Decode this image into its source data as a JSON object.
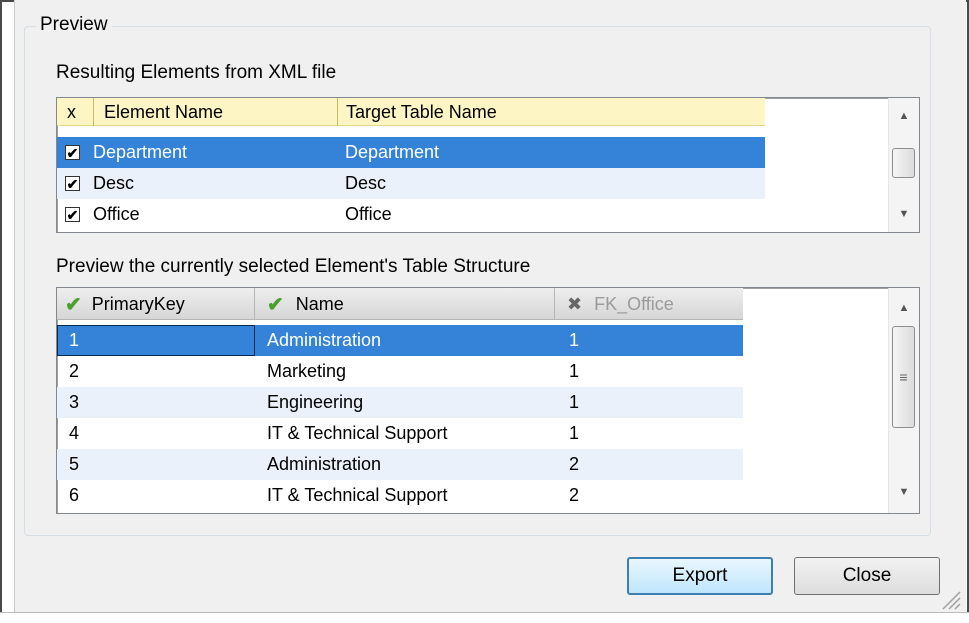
{
  "preview": {
    "group_title": "Preview",
    "elements_label": "Resulting Elements from XML file",
    "elements_table": {
      "headers": [
        "x",
        "Element Name",
        "Target Table Name"
      ],
      "rows": [
        {
          "checked": true,
          "element": "Department",
          "target": "Department",
          "selected": true
        },
        {
          "checked": true,
          "element": "Desc",
          "target": "Desc",
          "selected": false
        },
        {
          "checked": true,
          "element": "Office",
          "target": "Office",
          "selected": false
        }
      ]
    },
    "structure_label": "Preview the currently selected Element's Table Structure",
    "structure_table": {
      "headers": [
        {
          "label": "PrimaryKey",
          "icon": "check-icon"
        },
        {
          "label": "Name",
          "icon": "check-icon"
        },
        {
          "label": "FK_Office",
          "icon": "x-icon"
        }
      ],
      "rows": [
        [
          "1",
          "Administration",
          "1"
        ],
        [
          "2",
          "Marketing",
          "1"
        ],
        [
          "3",
          "Engineering",
          "1"
        ],
        [
          "4",
          "IT & Technical Support",
          "1"
        ],
        [
          "5",
          "Administration",
          "2"
        ],
        [
          "6",
          "IT & Technical Support",
          "2"
        ]
      ]
    }
  },
  "buttons": {
    "export": "Export",
    "close": "Close"
  },
  "colors": {
    "selection": "#3583d8",
    "header_highlight": "#fdf5c4",
    "alt_row": "#eaf1fb",
    "check_green": "#4aa02c"
  }
}
